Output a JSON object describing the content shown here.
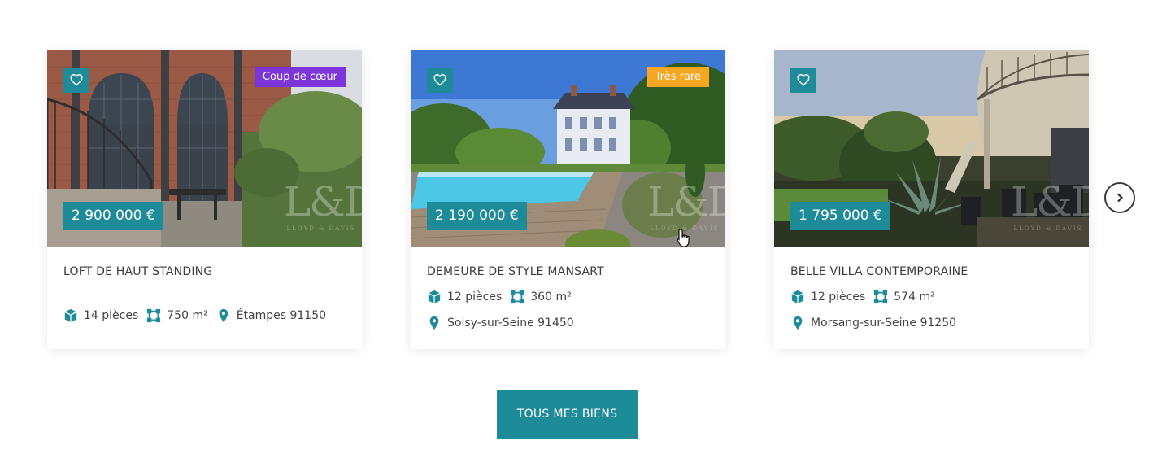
{
  "listings": [
    {
      "badge": "Coup de cœur",
      "badge_color": "#7b35d8",
      "price": "2 900 000 €",
      "title": "LOFT DE HAUT STANDING",
      "rooms": "14 pièces",
      "area": "750 m²",
      "location": "Étampes 91150",
      "watermark": "L&D",
      "watermark_sub": "LLOYD & DAVIS"
    },
    {
      "badge": "Très rare",
      "badge_color": "#f5a623",
      "price": "2 190 000 €",
      "title": "DEMEURE DE STYLE MANSART",
      "rooms": "12 pièces",
      "area": "360 m²",
      "location": "Soisy-sur-Seine 91450",
      "watermark": "L&D",
      "watermark_sub": "LLOYD & DAVIS"
    },
    {
      "badge": "",
      "price": "1 795 000 €",
      "title": "BELLE VILLA CONTEMPORAINE",
      "rooms": "12 pièces",
      "area": "574 m²",
      "location": "Morsang-sur-Seine 91250",
      "watermark": "L&D",
      "watermark_sub": "LLOYD & DAVIS"
    }
  ],
  "cta_label": "TOUS MES BIENS",
  "icons": {
    "favorite": "heart-icon",
    "rooms": "cube-icon",
    "area": "area-icon",
    "location": "map-pin-icon",
    "next": "chevron-right-icon"
  },
  "colors": {
    "accent": "#1e8b98",
    "badge_purple": "#7b35d8",
    "badge_yellow": "#f5a623"
  }
}
